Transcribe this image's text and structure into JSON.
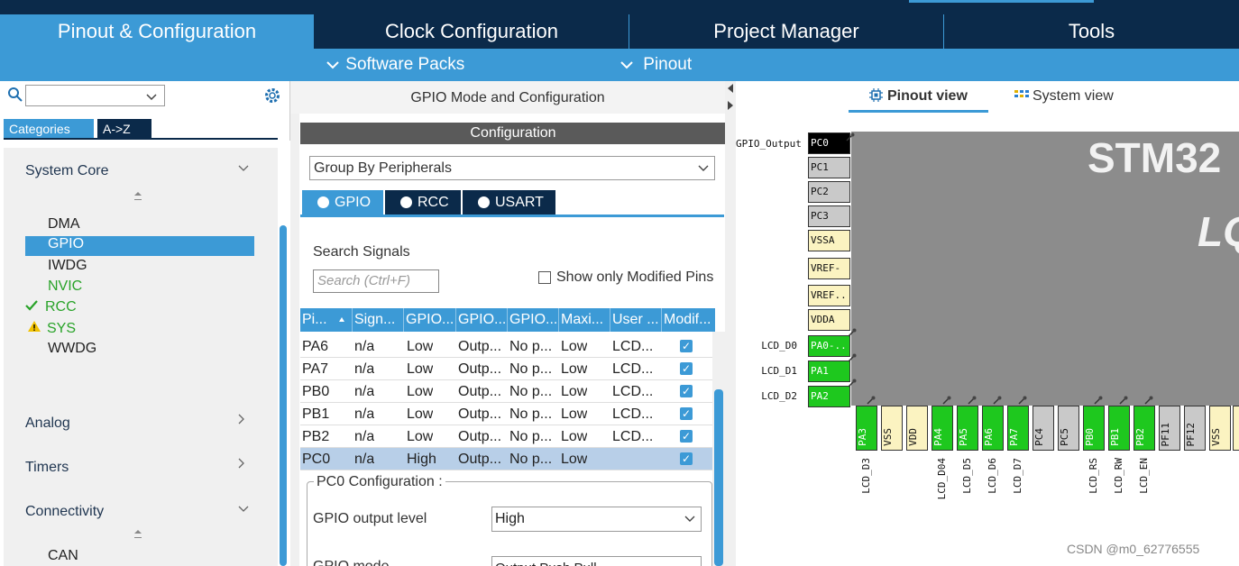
{
  "colors": {
    "navy": "#0b2a4a",
    "accent": "#3c9ad6",
    "green": "#1ec81e",
    "check_green": "#29a329"
  },
  "tabs": [
    {
      "label": "Pinout & Configuration"
    },
    {
      "label": "Clock Configuration"
    },
    {
      "label": "Project Manager"
    },
    {
      "label": "Tools"
    }
  ],
  "subbar": {
    "software_packs": "Software Packs",
    "pinout": "Pinout",
    "chevron": "chevron-down-icon"
  },
  "left": {
    "search": {
      "value": ""
    },
    "cat_tabs": {
      "categories": "Categories",
      "az": "A->Z"
    },
    "groups": {
      "system_core": "System Core",
      "analog": "Analog",
      "timers": "Timers",
      "connectivity": "Connectivity"
    },
    "core_items": [
      "DMA",
      "GPIO",
      "IWDG",
      "NVIC",
      "RCC",
      "SYS",
      "WWDG"
    ],
    "connectivity_items": [
      "CAN"
    ]
  },
  "mid": {
    "title": "GPIO Mode and Configuration",
    "config_header": "Configuration",
    "group_by": "Group By Peripherals",
    "periph_tabs": [
      "GPIO",
      "RCC",
      "USART"
    ],
    "search_label": "Search Signals",
    "search_placeholder": "Search (Ctrl+F)",
    "show_modified": "Show only Modified Pins",
    "columns": [
      "Pi...",
      "Sign...",
      "GPIO...",
      "GPIO...",
      "GPIO...",
      "Maxi...",
      "User ...",
      "Modif..."
    ],
    "rows": [
      {
        "pin": "PA6",
        "signal": "n/a",
        "level": "Low",
        "mode": "Outp...",
        "pull": "No p...",
        "speed": "Low",
        "label": "LCD...",
        "modified": true
      },
      {
        "pin": "PA7",
        "signal": "n/a",
        "level": "Low",
        "mode": "Outp...",
        "pull": "No p...",
        "speed": "Low",
        "label": "LCD...",
        "modified": true
      },
      {
        "pin": "PB0",
        "signal": "n/a",
        "level": "Low",
        "mode": "Outp...",
        "pull": "No p...",
        "speed": "Low",
        "label": "LCD...",
        "modified": true
      },
      {
        "pin": "PB1",
        "signal": "n/a",
        "level": "Low",
        "mode": "Outp...",
        "pull": "No p...",
        "speed": "Low",
        "label": "LCD...",
        "modified": true
      },
      {
        "pin": "PB2",
        "signal": "n/a",
        "level": "Low",
        "mode": "Outp...",
        "pull": "No p...",
        "speed": "Low",
        "label": "LCD...",
        "modified": true
      },
      {
        "pin": "PC0",
        "signal": "n/a",
        "level": "High",
        "mode": "Outp...",
        "pull": "No p...",
        "speed": "Low",
        "label": "",
        "modified": true
      }
    ],
    "pc0": {
      "legend": "PC0 Configuration :",
      "output_level_label": "GPIO output level",
      "output_level_value": "High",
      "mode_label": "GPIO mode",
      "mode_value": "Output Push Pull"
    }
  },
  "right": {
    "pinout_view": "Pinout view",
    "system_view": "System view",
    "chip_title": "STM32",
    "chip_sub": "LQ",
    "left_pins": [
      {
        "name": "PC0",
        "signal": "GPIO_Output",
        "color": "black"
      },
      {
        "name": "PC1",
        "signal": "",
        "color": "grey"
      },
      {
        "name": "PC2",
        "signal": "",
        "color": "grey"
      },
      {
        "name": "PC3",
        "signal": "",
        "color": "grey"
      },
      {
        "name": "VSSA",
        "signal": "",
        "color": "yellow"
      },
      {
        "name": "VREF-",
        "signal": "",
        "color": "yellow"
      },
      {
        "name": "VREF..",
        "signal": "",
        "color": "yellow"
      },
      {
        "name": "VDDA",
        "signal": "",
        "color": "yellow"
      },
      {
        "name": "PA0-..",
        "signal": "LCD_D0",
        "color": "green"
      },
      {
        "name": "PA1",
        "signal": "LCD_D1",
        "color": "green"
      },
      {
        "name": "PA2",
        "signal": "LCD_D2",
        "color": "green"
      }
    ],
    "bottom_pins": [
      {
        "name": "PA3",
        "signal": "LCD_D3",
        "color": "green"
      },
      {
        "name": "VSS",
        "signal": "",
        "color": "yellow"
      },
      {
        "name": "VDD",
        "signal": "",
        "color": "yellow"
      },
      {
        "name": "PA4",
        "signal": "LCD_D04",
        "color": "green"
      },
      {
        "name": "PA5",
        "signal": "LCD_D5",
        "color": "green"
      },
      {
        "name": "PA6",
        "signal": "LCD_D6",
        "color": "green"
      },
      {
        "name": "PA7",
        "signal": "LCD_D7",
        "color": "green"
      },
      {
        "name": "PC4",
        "signal": "",
        "color": "grey"
      },
      {
        "name": "PC5",
        "signal": "",
        "color": "grey"
      },
      {
        "name": "PB0",
        "signal": "LCD_RS",
        "color": "green"
      },
      {
        "name": "PB1",
        "signal": "LCD_RW",
        "color": "green"
      },
      {
        "name": "PB2",
        "signal": "LCD_EN",
        "color": "green"
      },
      {
        "name": "PF11",
        "signal": "",
        "color": "grey"
      },
      {
        "name": "PF12",
        "signal": "",
        "color": "grey"
      },
      {
        "name": "VSS",
        "signal": "",
        "color": "yellow"
      },
      {
        "name": "",
        "signal": "",
        "color": "yellow"
      }
    ]
  },
  "watermark": "CSDN @m0_62776555"
}
